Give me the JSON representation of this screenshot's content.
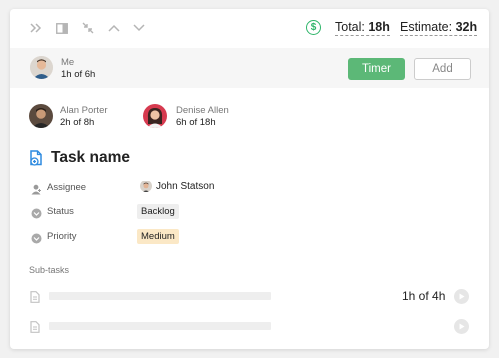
{
  "header": {
    "total_label": "Total: ",
    "total_value": "18h",
    "estimate_label": "Estimate: ",
    "estimate_value": "32h"
  },
  "me": {
    "name": "Me",
    "hours": "1h of 6h"
  },
  "buttons": {
    "timer": "Timer",
    "add": "Add"
  },
  "assignees_time": [
    {
      "name": "Alan Porter",
      "hours": "2h of 8h"
    },
    {
      "name": "Denise Allen",
      "hours": "6h of 18h"
    }
  ],
  "task": {
    "title": "Task name",
    "properties": {
      "assignee_label": "Assignee",
      "assignee_value": "John Statson",
      "status_label": "Status",
      "status_value": "Backlog",
      "priority_label": "Priority",
      "priority_value": "Medium"
    }
  },
  "subtasks": {
    "heading": "Sub-tasks",
    "items": [
      {
        "hours": "1h of 4h"
      },
      {
        "hours": ""
      }
    ]
  },
  "colors": {
    "accent_green": "#5cb877",
    "dollar_green": "#2fb56a",
    "task_icon_blue": "#2f8be0",
    "status_bg": "#eeeeee",
    "priority_bg": "#fbe8c6"
  },
  "icons": [
    "expand-double-chevron-icon",
    "sidebar-panel-icon",
    "collapse-arrows-icon",
    "chevron-up-icon",
    "chevron-down-icon",
    "dollar-icon",
    "task-document-icon",
    "assignee-person-icon",
    "status-dot-icon",
    "priority-dot-icon",
    "document-icon",
    "play-icon"
  ]
}
